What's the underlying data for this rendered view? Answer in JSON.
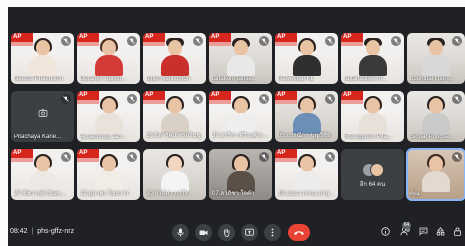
{
  "meeting": {
    "time": "08:42",
    "separator": "|",
    "code": "phs-gffz-nrz",
    "participant_badge": "64",
    "others_label": "อีก 64 คน"
  },
  "banner_text": "AP",
  "tiles": [
    {
      "name": "Natcha Phaensirin",
      "muted": true,
      "bg": "red",
      "banner": true
    },
    {
      "name": "Duranee Sukch...",
      "muted": true,
      "bg": "red",
      "banner": true
    },
    {
      "name": "nipon kankomon",
      "muted": true,
      "bg": "red",
      "banner": true
    },
    {
      "name": "tanakorn tantik...",
      "muted": true,
      "bg": "room",
      "banner": true
    },
    {
      "name": "Raweepat KL",
      "muted": true,
      "bg": "red",
      "banner": true
    },
    {
      "name": "rattanadilee m...",
      "muted": true,
      "bg": "red",
      "banner": true
    },
    {
      "name": "boonthai l porn...",
      "muted": true,
      "bg": "room",
      "banner": false
    },
    {
      "name": "Pitachaya Kane...",
      "muted": true,
      "bg": "blank",
      "camera_off": true
    },
    {
      "name": "Aj.Jarinong Jan...",
      "muted": true,
      "bg": "red",
      "banner": true
    },
    {
      "name": "16.ธิดารัตน์ พรมโมชู",
      "muted": true,
      "bg": "red",
      "banner": true
    },
    {
      "name": "37.ดาริกา ศิริวงศ์ ตา...",
      "muted": true,
      "bg": "red",
      "banner": true
    },
    {
      "name": "05.กรรณิกา บุญวิชัย",
      "muted": true,
      "bg": "room",
      "banner": true
    },
    {
      "name": "Roongphon Pita...",
      "muted": true,
      "bg": "red",
      "banner": true
    },
    {
      "name": "Sirinat Pongsa...",
      "muted": true,
      "bg": "room",
      "banner": false
    },
    {
      "name": "27.ชัชวาลย์ กันทะ...",
      "muted": true,
      "bg": "red",
      "banner": true
    },
    {
      "name": "19.สุภาพร ไชยวาร",
      "muted": true,
      "bg": "red",
      "banner": true
    },
    {
      "name": "30.ปาลิดา ภาโท",
      "muted": true,
      "bg": "room",
      "banner": false
    },
    {
      "name": "07.ลาภิชา ใจคำ",
      "muted": true,
      "bg": "dark",
      "banner": false
    },
    {
      "name": "19.จมนาวรรณ สากุลิตา",
      "muted": true,
      "bg": "red",
      "banner": true
    },
    {
      "name": "อีก 64 คน",
      "muted": false,
      "bg": "blank",
      "others": true
    },
    {
      "name": "คุณ",
      "muted": true,
      "bg": "room",
      "banner": false,
      "active": true
    }
  ],
  "icons": {
    "mic": "mic-icon",
    "camera": "camera-icon",
    "raise_hand": "raise-hand-icon",
    "present": "present-icon",
    "more": "more-options-icon",
    "hangup": "hang-up-icon",
    "info": "info-icon",
    "people": "people-icon",
    "chat": "chat-icon",
    "activities": "activities-icon",
    "host": "host-controls-icon"
  },
  "colors": {
    "accent": "#8ab4f8",
    "hangup": "#ea4335",
    "banner": "#d7261e"
  }
}
